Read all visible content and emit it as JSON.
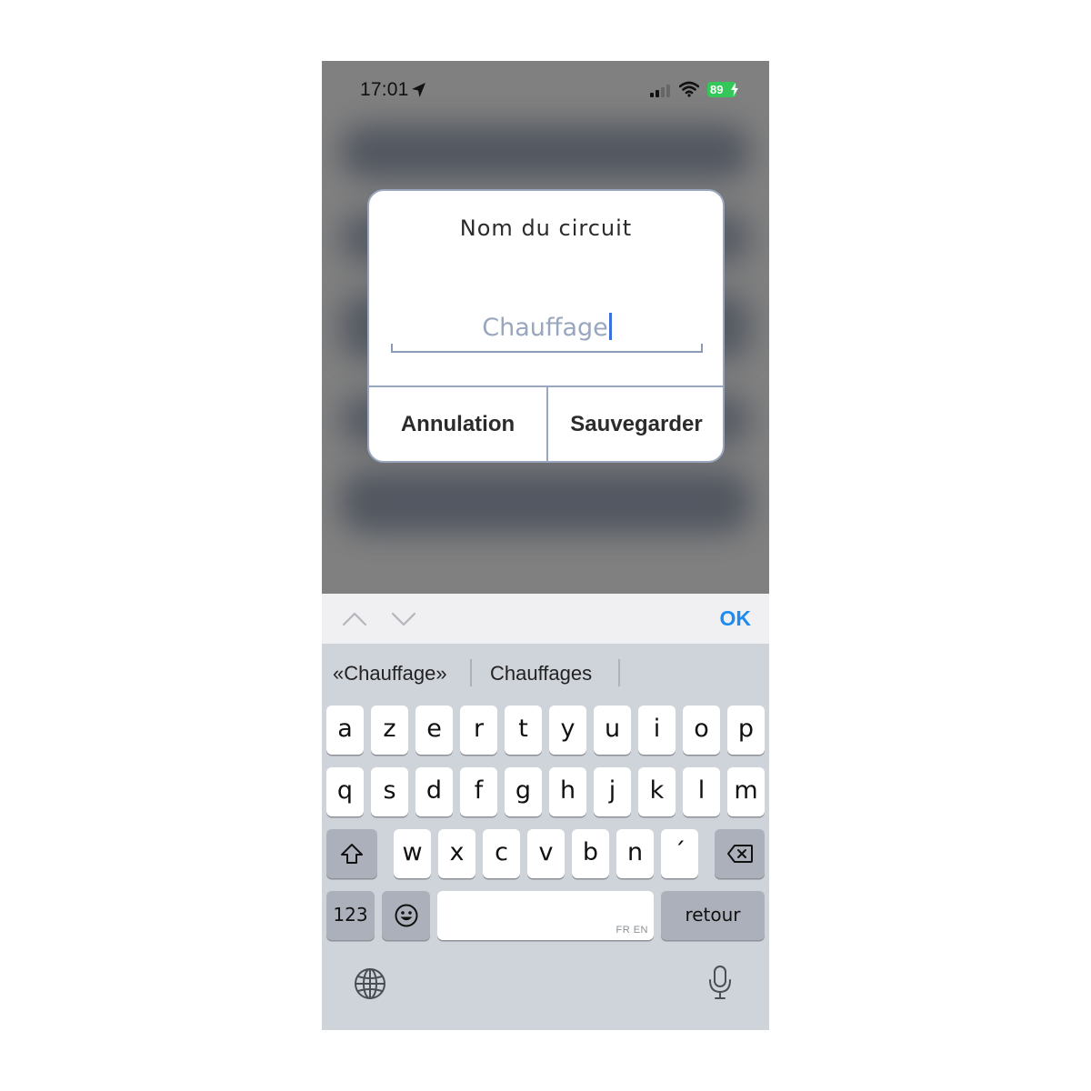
{
  "status_bar": {
    "time": "17:01",
    "battery": "89",
    "icons": [
      "location-arrow-icon",
      "signal-bars-icon",
      "wifi-icon",
      "battery-icon",
      "charging-bolt-icon"
    ]
  },
  "dialog": {
    "title": "Nom du circuit",
    "input_value": "Chauffage",
    "cancel_label": "Annulation",
    "save_label": "Sauvegarder"
  },
  "accessory_bar": {
    "done_label": "OK",
    "icons": [
      "chevron-up-icon",
      "chevron-down-icon"
    ]
  },
  "keyboard": {
    "suggestions": [
      "«Chauffage»",
      "Chauffages"
    ],
    "row1": [
      "a",
      "z",
      "e",
      "r",
      "t",
      "y",
      "u",
      "i",
      "o",
      "p"
    ],
    "row2": [
      "q",
      "s",
      "d",
      "f",
      "g",
      "h",
      "j",
      "k",
      "l",
      "m"
    ],
    "row3": [
      "w",
      "x",
      "c",
      "v",
      "b",
      "n",
      "´"
    ],
    "numbers_label": "123",
    "space_hint": "FR EN",
    "return_label": "retour",
    "icons": [
      "shift-icon",
      "backspace-icon",
      "emoji-icon",
      "globe-icon",
      "microphone-icon"
    ]
  },
  "colors": {
    "accent": "#1c8cf0",
    "caret": "#3b6fe0",
    "battery": "#34c759",
    "placeholder": "#98a7bd"
  }
}
